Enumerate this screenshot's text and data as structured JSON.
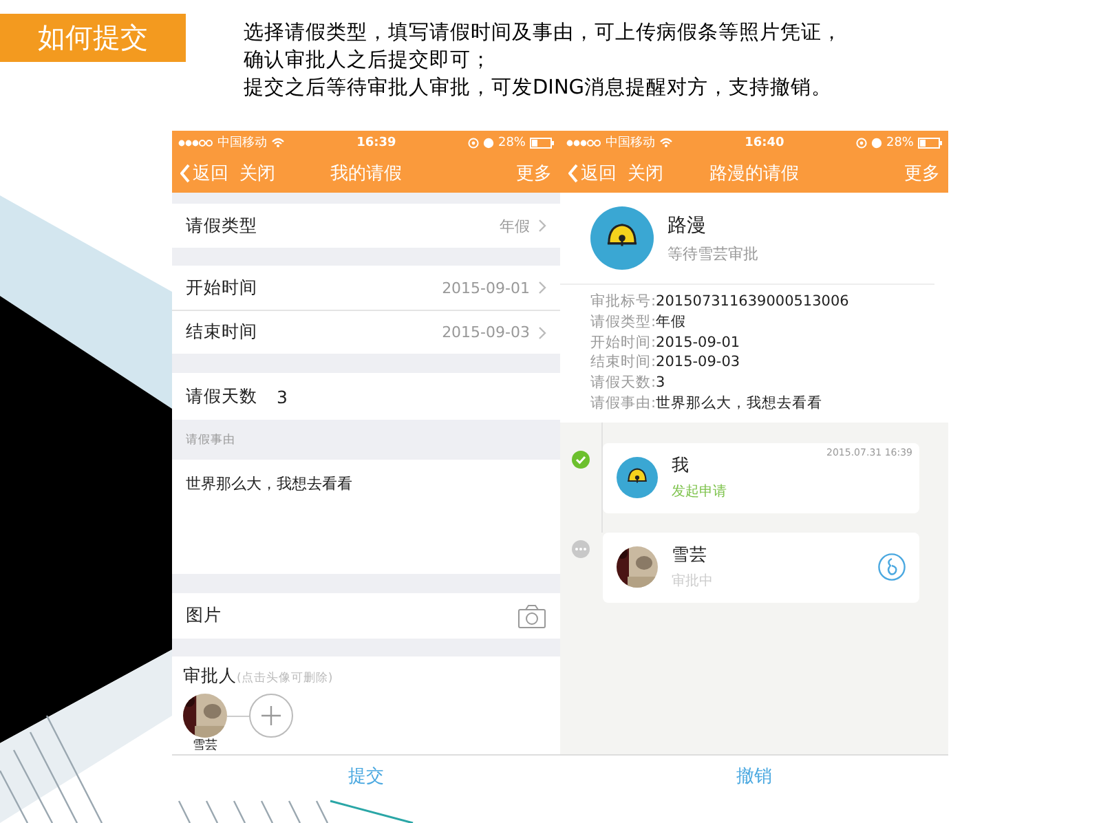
{
  "slide": {
    "title": "如何提交",
    "description": [
      "选择请假类型，填写请假时间及事由，可上传病假条等照片凭证，",
      "确认审批人之后提交即可；",
      "提交之后等待审批人审批，可发DING消息提醒对方，支持撤销。"
    ]
  },
  "phones": [
    {
      "kind": "form",
      "status": {
        "carrier": "中国移动",
        "time": "16:39",
        "battery": "28%"
      },
      "nav": {
        "back": "返回",
        "close": "关闭",
        "title": "我的请假",
        "more": "更多"
      },
      "groups": [
        [
          {
            "label": "请假类型",
            "value": "年假"
          }
        ],
        [
          {
            "label": "开始时间",
            "value": "2015-09-01"
          },
          {
            "label": "结束时间",
            "value": "2015-09-03"
          }
        ]
      ],
      "days": {
        "label": "请假天数",
        "value": "3"
      },
      "reason": {
        "label": "请假事由",
        "value": "世界那么大，我想去看看"
      },
      "photos": {
        "label": "图片"
      },
      "approvers": {
        "label": "审批人",
        "hint": "(点击头像可删除)",
        "people": [
          {
            "name": "雪芸"
          }
        ]
      },
      "action": "提交"
    },
    {
      "kind": "detail",
      "status": {
        "carrier": "中国移动",
        "time": "16:40",
        "battery": "28%"
      },
      "nav": {
        "back": "返回",
        "close": "关闭",
        "title": "路漫的请假",
        "more": "更多"
      },
      "applicant": {
        "name": "路漫",
        "status": "等待雪芸审批",
        "avatar": {
          "kind": "bell"
        }
      },
      "details": [
        {
          "label": "审批标号:",
          "value": "201507311639000513006"
        },
        {
          "label": "请假类型:",
          "value": "年假"
        },
        {
          "label": "开始时间:",
          "value": "2015-09-01"
        },
        {
          "label": "结束时间:",
          "value": "2015-09-03"
        },
        {
          "label": "请假天数:",
          "value": "3"
        },
        {
          "label": "请假事由:",
          "value": "世界那么大，我想去看看"
        }
      ],
      "timeline": [
        {
          "name": "我",
          "status": "发起申请",
          "time": "2015.07.31 16:39",
          "avatar": {
            "kind": "bell"
          },
          "done": true
        },
        {
          "name": "雪芸",
          "status": "审批中",
          "done": false
        }
      ],
      "action": "撤销"
    }
  ]
}
